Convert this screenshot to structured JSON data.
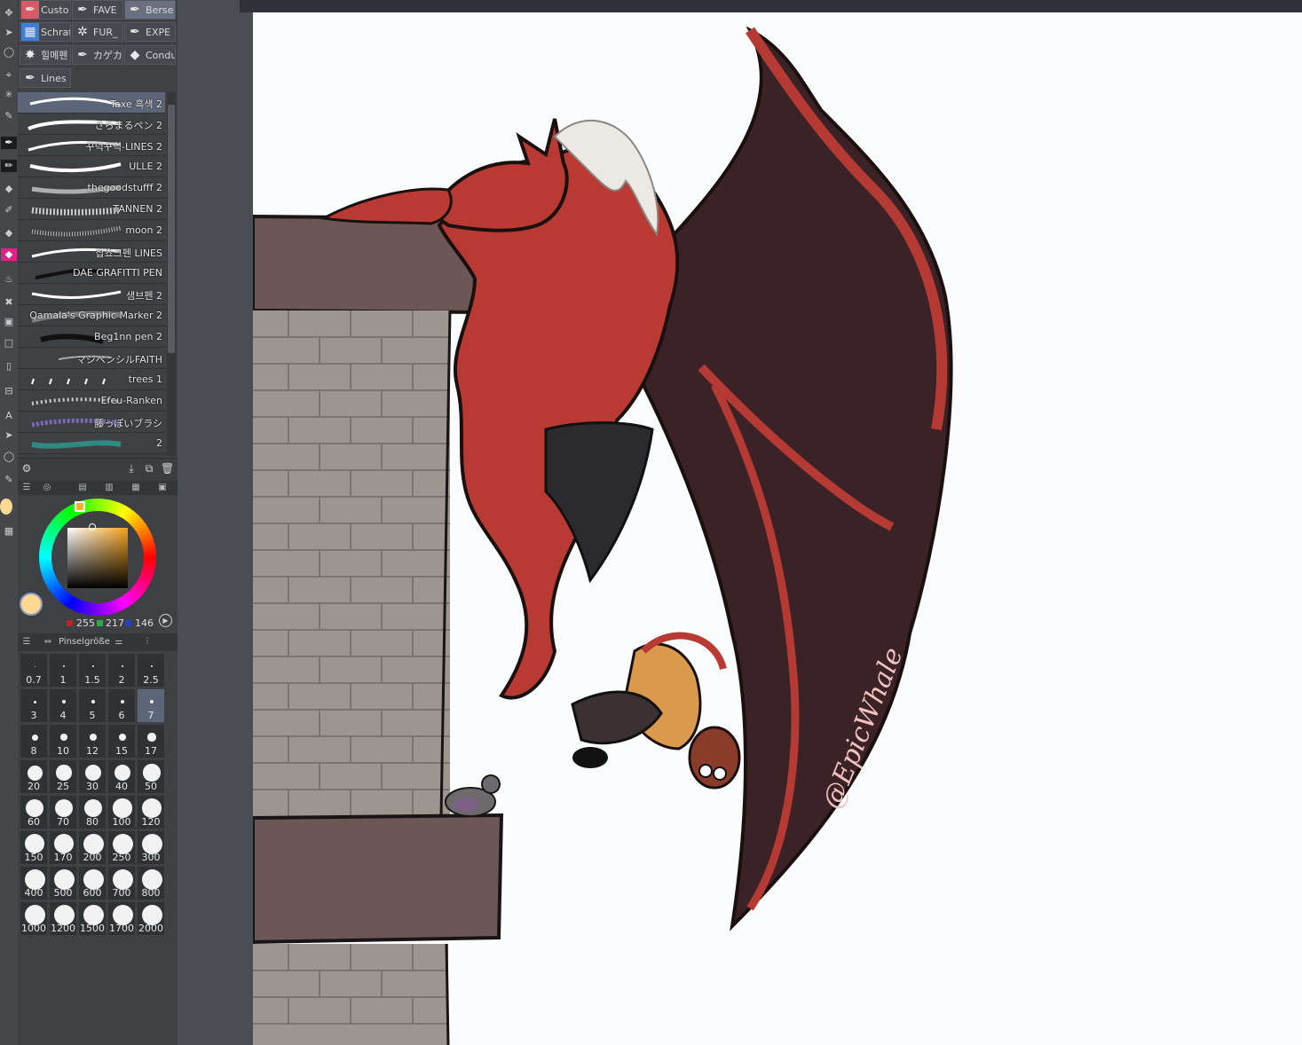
{
  "brush_tabs": [
    {
      "label": "Custo",
      "icon": "pen-icon",
      "active": false
    },
    {
      "label": "FAVE",
      "icon": "pen-icon",
      "active": false
    },
    {
      "label": "Berse",
      "icon": "pen-icon",
      "active": true
    },
    {
      "label": "Schraf",
      "icon": "hatch-icon",
      "active": false
    },
    {
      "label": "FUR_",
      "icon": "fur-icon",
      "active": false
    },
    {
      "label": "EXPE",
      "icon": "pen-icon",
      "active": false
    },
    {
      "label": "힐메펜",
      "icon": "splat-icon",
      "active": false
    },
    {
      "label": "カゲカ",
      "icon": "pen-icon",
      "active": false
    },
    {
      "label": "Condu",
      "icon": "diamond-icon",
      "active": false
    },
    {
      "label": "Lines",
      "icon": "pen-icon",
      "active": false
    }
  ],
  "brushes": [
    {
      "name": "Taxe 흑색 2",
      "active": true
    },
    {
      "name": "さらまるペン 2",
      "active": false
    },
    {
      "name": "꾸덕꾸덕-LINES 2",
      "active": false
    },
    {
      "name": "ULLE 2",
      "active": false
    },
    {
      "name": "thegoodstufff 2",
      "active": false
    },
    {
      "name": "TANNEN 2",
      "active": false
    },
    {
      "name": "moon 2",
      "active": false
    },
    {
      "name": "찹쵸크펜 LINES",
      "active": false
    },
    {
      "name": "DAE GRAFITTI PEN",
      "active": false
    },
    {
      "name": "샘브펜 2",
      "active": false
    },
    {
      "name": "Qamala's Graphic Marker 2",
      "active": false
    },
    {
      "name": "Beg1nn pen 2",
      "active": false
    },
    {
      "name": "マジペンシルFAITH",
      "active": false
    },
    {
      "name": "trees 1",
      "active": false
    },
    {
      "name": "Efeu-Ranken",
      "active": false
    },
    {
      "name": "藤っぽいブラシ",
      "active": false
    },
    {
      "name": "2",
      "active": false
    }
  ],
  "color": {
    "r": "255",
    "g": "217",
    "b": "146",
    "current_hex": "#ffd992"
  },
  "size_panel": {
    "label": "Pinselgröße",
    "sizes": [
      "0.7",
      "1",
      "1.5",
      "2",
      "2.5",
      "3",
      "4",
      "5",
      "6",
      "7",
      "8",
      "10",
      "12",
      "15",
      "17",
      "20",
      "25",
      "30",
      "40",
      "50",
      "60",
      "70",
      "80",
      "100",
      "120",
      "150",
      "170",
      "200",
      "250",
      "300",
      "400",
      "500",
      "600",
      "700",
      "800",
      "1000",
      "1200",
      "1500",
      "1700",
      "2000"
    ],
    "selected": "7"
  },
  "canvas": {
    "watermark": "@EpicWhale"
  }
}
